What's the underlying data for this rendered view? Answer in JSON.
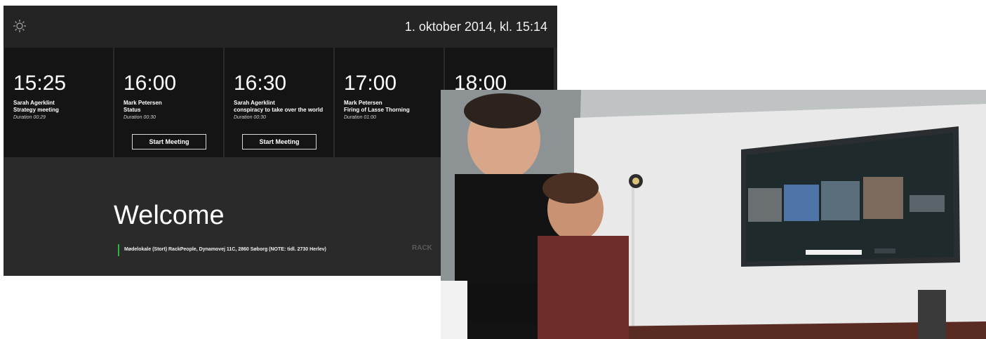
{
  "header": {
    "datetime": "1. oktober 2014, kl. 15:14",
    "settings_icon": "gear-icon"
  },
  "slots": [
    {
      "time": "15:25",
      "organizer": "Sarah Agerklint",
      "subject": "Strategy meeting",
      "duration": "Duration 00:29"
    },
    {
      "time": "16:00",
      "organizer": "Mark Petersen",
      "subject": "Status",
      "duration": "Duration 00:30",
      "button": "Start Meeting"
    },
    {
      "time": "16:30",
      "organizer": "Sarah Agerklint",
      "subject": "conspiracy to take over the world",
      "duration": "Duration 00:30",
      "button": "Start Meeting"
    },
    {
      "time": "17:00",
      "organizer": "Mark Petersen",
      "subject": "Firing of Lasse Thorning",
      "duration": "Duration 01:00"
    },
    {
      "time": "18:00"
    }
  ],
  "main": {
    "welcome": "Welcome",
    "location": "Mødelokale (Stort) RackPeople, Dynamovej 11C, 2860 Søborg (NOTE: tidl. 2730 Herlev)",
    "brand": "RACK"
  },
  "colors": {
    "panel_bg": "#2a2a2a",
    "slot_bg": "#141414",
    "accent_green": "#2db53c"
  }
}
